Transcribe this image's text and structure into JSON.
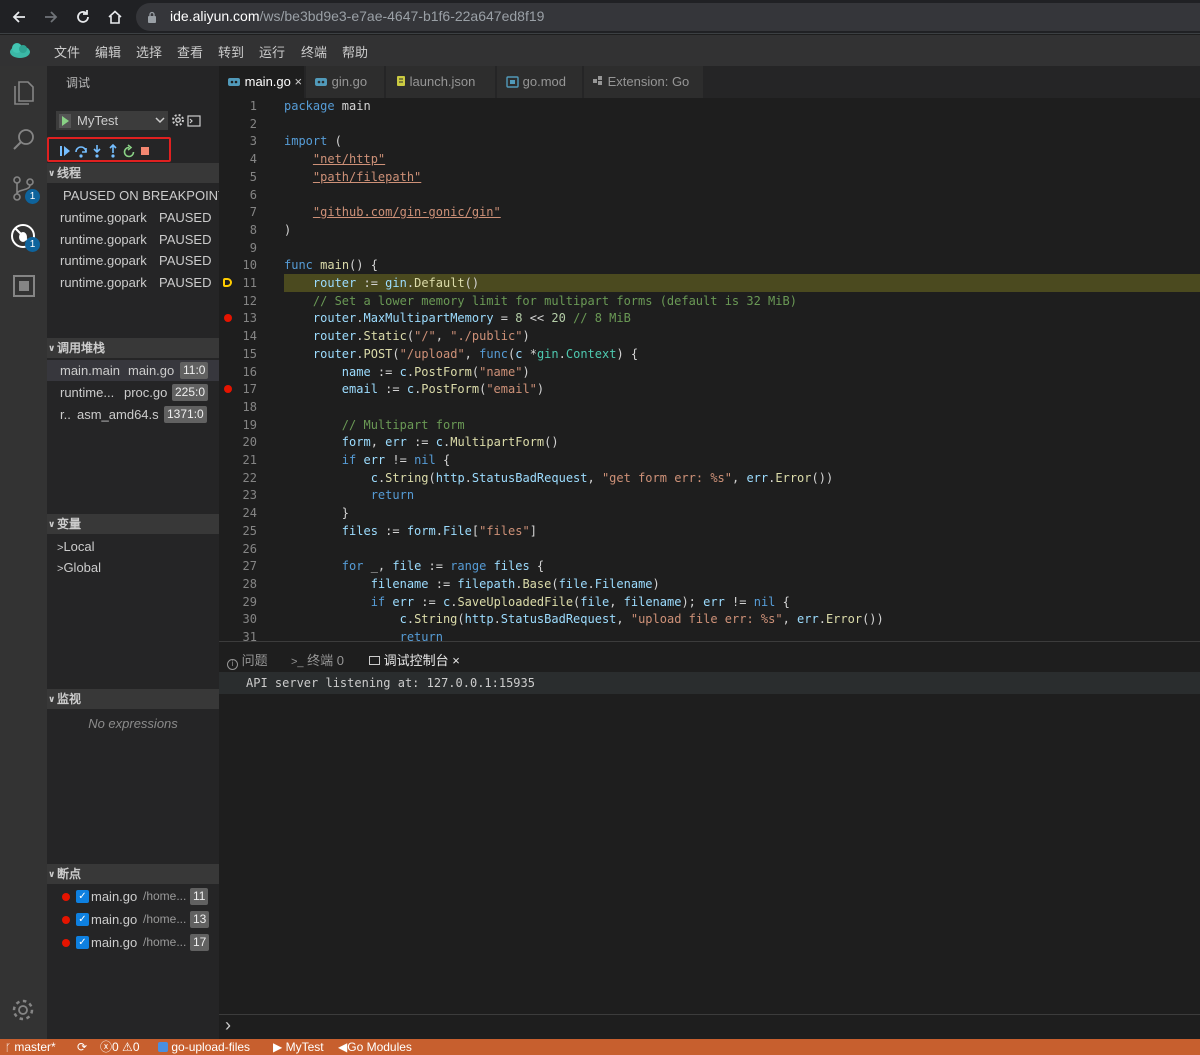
{
  "browser": {
    "url_host": "ide.aliyun.com",
    "url_path": "/ws/be3bd9e3-e7ae-4647-b1f6-22a647ed8f19"
  },
  "menu": [
    "文件",
    "编辑",
    "选择",
    "查看",
    "转到",
    "运行",
    "终端",
    "帮助"
  ],
  "activity_badges": {
    "scm": "1",
    "debug": "1"
  },
  "sidebar": {
    "title": "调试",
    "config_name": "MyTest",
    "threads": {
      "header": "线程",
      "status": "PAUSED ON BREAKPOINT",
      "items": [
        {
          "name": "runtime.gopark",
          "state": "PAUSED"
        },
        {
          "name": "runtime.gopark",
          "state": "PAUSED"
        },
        {
          "name": "runtime.gopark",
          "state": "PAUSED"
        },
        {
          "name": "runtime.gopark",
          "state": "PAUSED"
        }
      ]
    },
    "callstack": {
      "header": "调用堆栈",
      "items": [
        {
          "fn": "main.main",
          "file": "main.go",
          "pos": "11:0"
        },
        {
          "fn": "runtime...",
          "file": "proc.go",
          "pos": "225:0"
        },
        {
          "fn": "r..",
          "file": "asm_amd64.s",
          "pos": "1371:0"
        }
      ]
    },
    "variables": {
      "header": "变量",
      "items": [
        "Local",
        "Global"
      ]
    },
    "watch": {
      "header": "监视",
      "empty": "No expressions"
    },
    "breakpoints": {
      "header": "断点",
      "items": [
        {
          "file": "main.go",
          "path": "/home...",
          "line": "11"
        },
        {
          "file": "main.go",
          "path": "/home...",
          "line": "13"
        },
        {
          "file": "main.go",
          "path": "/home...",
          "line": "17"
        }
      ]
    }
  },
  "tabs": [
    {
      "label": "main.go",
      "active": true
    },
    {
      "label": "gin.go"
    },
    {
      "label": "launch.json"
    },
    {
      "label": "go.mod"
    },
    {
      "label": "Extension: Go"
    }
  ],
  "code": [
    [
      [
        "k",
        "package"
      ],
      [
        "p",
        " main"
      ]
    ],
    [],
    [
      [
        "k",
        "import"
      ],
      [
        "p",
        " ("
      ]
    ],
    [
      [
        "p",
        "    "
      ],
      [
        "s",
        "\"net/http\""
      ]
    ],
    [
      [
        "p",
        "    "
      ],
      [
        "s",
        "\"path/filepath\""
      ]
    ],
    [],
    [
      [
        "p",
        "    "
      ],
      [
        "s",
        "\"github.com/gin-gonic/gin\""
      ]
    ],
    [
      [
        "p",
        ")"
      ]
    ],
    [],
    [
      [
        "k",
        "func"
      ],
      [
        "p",
        " "
      ],
      [
        "f",
        "main"
      ],
      [
        "p",
        "() {"
      ]
    ],
    [
      [
        "p",
        "    "
      ],
      [
        "v",
        "router"
      ],
      [
        "p",
        " := "
      ],
      [
        "v",
        "gin"
      ],
      [
        "p",
        "."
      ],
      [
        "f",
        "Default"
      ],
      [
        "p",
        "()"
      ]
    ],
    [
      [
        "p",
        "    "
      ],
      [
        "c",
        "// Set a lower memory limit for multipart forms (default is 32 MiB)"
      ]
    ],
    [
      [
        "p",
        "    "
      ],
      [
        "v",
        "router"
      ],
      [
        "p",
        "."
      ],
      [
        "v",
        "MaxMultipartMemory"
      ],
      [
        "p",
        " = "
      ],
      [
        "n",
        "8"
      ],
      [
        "p",
        " << "
      ],
      [
        "n",
        "20"
      ],
      [
        "p",
        " "
      ],
      [
        "c",
        "// 8 MiB"
      ]
    ],
    [
      [
        "p",
        "    "
      ],
      [
        "v",
        "router"
      ],
      [
        "p",
        "."
      ],
      [
        "f",
        "Static"
      ],
      [
        "p",
        "("
      ],
      [
        "s2",
        "\"/\""
      ],
      [
        "p",
        ", "
      ],
      [
        "s2",
        "\"./public\""
      ],
      [
        "p",
        ")"
      ]
    ],
    [
      [
        "p",
        "    "
      ],
      [
        "v",
        "router"
      ],
      [
        "p",
        "."
      ],
      [
        "f",
        "POST"
      ],
      [
        "p",
        "("
      ],
      [
        "s2",
        "\"/upload\""
      ],
      [
        "p",
        ", "
      ],
      [
        "k",
        "func"
      ],
      [
        "p",
        "("
      ],
      [
        "v",
        "c"
      ],
      [
        "p",
        " *"
      ],
      [
        "t",
        "gin"
      ],
      [
        "p",
        "."
      ],
      [
        "t",
        "Context"
      ],
      [
        "p",
        ") {"
      ]
    ],
    [
      [
        "p",
        "        "
      ],
      [
        "v",
        "name"
      ],
      [
        "p",
        " := "
      ],
      [
        "v",
        "c"
      ],
      [
        "p",
        "."
      ],
      [
        "f",
        "PostForm"
      ],
      [
        "p",
        "("
      ],
      [
        "s2",
        "\"name\""
      ],
      [
        "p",
        ")"
      ]
    ],
    [
      [
        "p",
        "        "
      ],
      [
        "v",
        "email"
      ],
      [
        "p",
        " := "
      ],
      [
        "v",
        "c"
      ],
      [
        "p",
        "."
      ],
      [
        "f",
        "PostForm"
      ],
      [
        "p",
        "("
      ],
      [
        "s2",
        "\"email\""
      ],
      [
        "p",
        ")"
      ]
    ],
    [],
    [
      [
        "p",
        "        "
      ],
      [
        "c",
        "// Multipart form"
      ]
    ],
    [
      [
        "p",
        "        "
      ],
      [
        "v",
        "form"
      ],
      [
        "p",
        ", "
      ],
      [
        "v",
        "err"
      ],
      [
        "p",
        " := "
      ],
      [
        "v",
        "c"
      ],
      [
        "p",
        "."
      ],
      [
        "f",
        "MultipartForm"
      ],
      [
        "p",
        "()"
      ]
    ],
    [
      [
        "p",
        "        "
      ],
      [
        "k",
        "if"
      ],
      [
        "p",
        " "
      ],
      [
        "v",
        "err"
      ],
      [
        "p",
        " != "
      ],
      [
        "k",
        "nil"
      ],
      [
        "p",
        " {"
      ]
    ],
    [
      [
        "p",
        "            "
      ],
      [
        "v",
        "c"
      ],
      [
        "p",
        "."
      ],
      [
        "f",
        "String"
      ],
      [
        "p",
        "("
      ],
      [
        "v",
        "http"
      ],
      [
        "p",
        "."
      ],
      [
        "v",
        "StatusBadRequest"
      ],
      [
        "p",
        ", "
      ],
      [
        "s2",
        "\"get form err: %s\""
      ],
      [
        "p",
        ", "
      ],
      [
        "v",
        "err"
      ],
      [
        "p",
        "."
      ],
      [
        "f",
        "Error"
      ],
      [
        "p",
        "())"
      ]
    ],
    [
      [
        "p",
        "            "
      ],
      [
        "k",
        "return"
      ]
    ],
    [
      [
        "p",
        "        }"
      ]
    ],
    [
      [
        "p",
        "        "
      ],
      [
        "v",
        "files"
      ],
      [
        "p",
        " := "
      ],
      [
        "v",
        "form"
      ],
      [
        "p",
        "."
      ],
      [
        "v",
        "File"
      ],
      [
        "p",
        "["
      ],
      [
        "s2",
        "\"files\""
      ],
      [
        "p",
        "]"
      ]
    ],
    [],
    [
      [
        "p",
        "        "
      ],
      [
        "k",
        "for"
      ],
      [
        "p",
        " _, "
      ],
      [
        "v",
        "file"
      ],
      [
        "p",
        " := "
      ],
      [
        "k",
        "range"
      ],
      [
        "p",
        " "
      ],
      [
        "v",
        "files"
      ],
      [
        "p",
        " {"
      ]
    ],
    [
      [
        "p",
        "            "
      ],
      [
        "v",
        "filename"
      ],
      [
        "p",
        " := "
      ],
      [
        "v",
        "filepath"
      ],
      [
        "p",
        "."
      ],
      [
        "f",
        "Base"
      ],
      [
        "p",
        "("
      ],
      [
        "v",
        "file"
      ],
      [
        "p",
        "."
      ],
      [
        "v",
        "Filename"
      ],
      [
        "p",
        ")"
      ]
    ],
    [
      [
        "p",
        "            "
      ],
      [
        "k",
        "if"
      ],
      [
        "p",
        " "
      ],
      [
        "v",
        "err"
      ],
      [
        "p",
        " := "
      ],
      [
        "v",
        "c"
      ],
      [
        "p",
        "."
      ],
      [
        "f",
        "SaveUploadedFile"
      ],
      [
        "p",
        "("
      ],
      [
        "v",
        "file"
      ],
      [
        "p",
        ", "
      ],
      [
        "v",
        "filename"
      ],
      [
        "p",
        "); "
      ],
      [
        "v",
        "err"
      ],
      [
        "p",
        " != "
      ],
      [
        "k",
        "nil"
      ],
      [
        "p",
        " {"
      ]
    ],
    [
      [
        "p",
        "                "
      ],
      [
        "v",
        "c"
      ],
      [
        "p",
        "."
      ],
      [
        "f",
        "String"
      ],
      [
        "p",
        "("
      ],
      [
        "v",
        "http"
      ],
      [
        "p",
        "."
      ],
      [
        "v",
        "StatusBadRequest"
      ],
      [
        "p",
        ", "
      ],
      [
        "s2",
        "\"upload file err: %s\""
      ],
      [
        "p",
        ", "
      ],
      [
        "v",
        "err"
      ],
      [
        "p",
        "."
      ],
      [
        "f",
        "Error"
      ],
      [
        "p",
        "())"
      ]
    ],
    [
      [
        "p",
        "                "
      ],
      [
        "k",
        "return"
      ]
    ]
  ],
  "code_meta": {
    "current_line": 11,
    "breakpoint_lines": [
      13,
      17
    ]
  },
  "panel": {
    "tabs": {
      "problems": "问题",
      "terminal": "终端 0",
      "debug_console": "调试控制台"
    },
    "output": "API server listening at: 127.0.0.1:15935",
    "prompt": "›"
  },
  "status": {
    "branch": "master*",
    "errors": "0",
    "warnings": "0",
    "project": "go-upload-files",
    "config": "MyTest",
    "modules": "Go Modules"
  },
  "colors": {
    "accent": "#0e639c",
    "status_bar": "#c75f2e",
    "breakpoint": "#e51400",
    "highlight": "#4b4a1f"
  }
}
